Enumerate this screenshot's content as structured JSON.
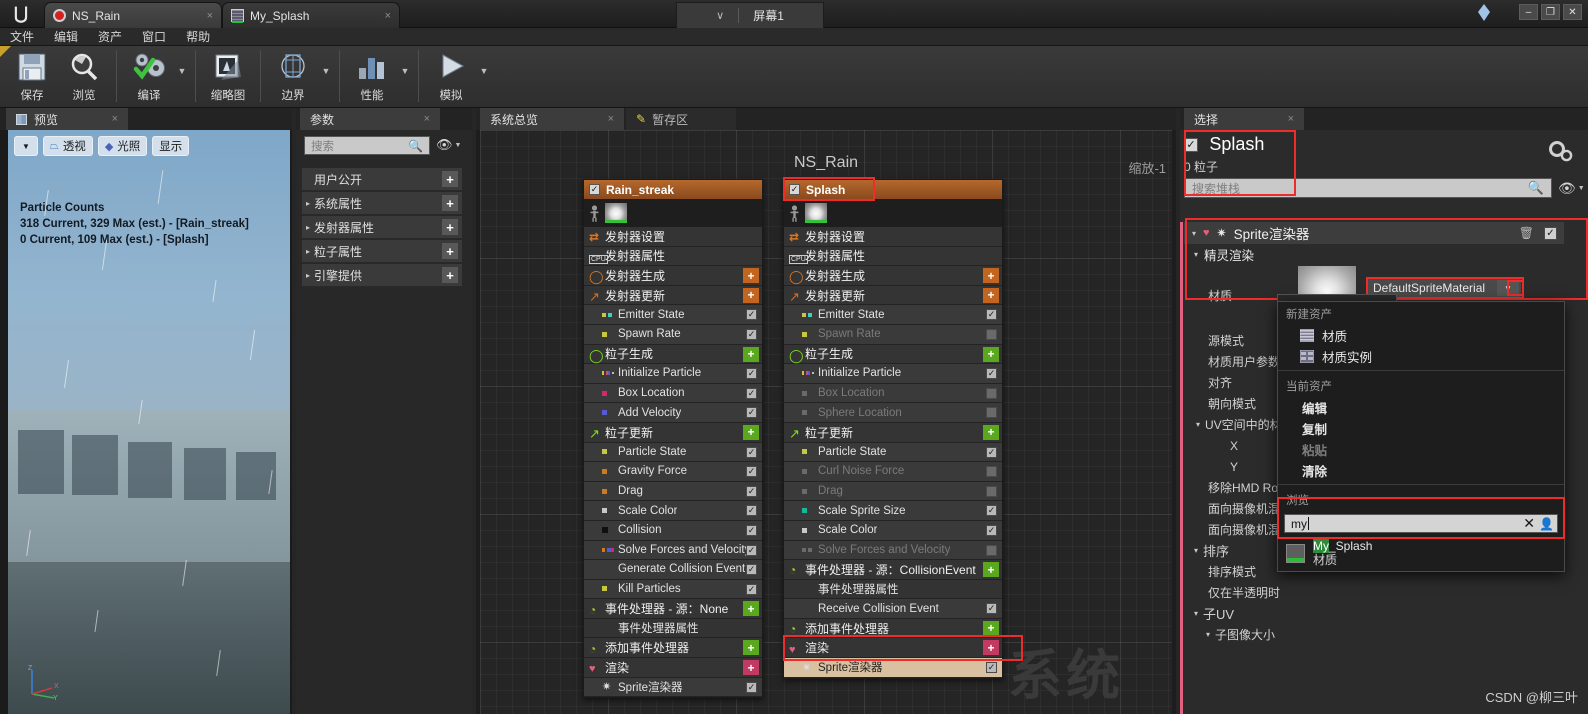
{
  "titlebar": {
    "logo": "ue-logo",
    "tabs": [
      {
        "label": "NS_Rain",
        "icon": "niagara-system-icon",
        "close": "×"
      },
      {
        "label": "My_Splash",
        "icon": "material-icon",
        "close": "×"
      }
    ],
    "screen_selector": {
      "chevron": "∨",
      "label": "屏幕1"
    },
    "window_controls": {
      "minimize": "–",
      "maximize": "❐",
      "close": "✕"
    }
  },
  "menubar": {
    "items": [
      "文件",
      "编辑",
      "资产",
      "窗口",
      "帮助"
    ]
  },
  "toolbar": {
    "items": [
      {
        "label": "保存",
        "icon": "save-icon",
        "arrow": false
      },
      {
        "label": "浏览",
        "icon": "browse-icon",
        "arrow": false
      },
      {
        "label": "编译",
        "icon": "compile-icon",
        "arrow": true
      },
      {
        "label": "缩略图",
        "icon": "thumbnail-icon",
        "arrow": false
      },
      {
        "label": "边界",
        "icon": "bounds-icon",
        "arrow": true
      },
      {
        "label": "性能",
        "icon": "performance-icon",
        "arrow": true
      },
      {
        "label": "模拟",
        "icon": "simulate-icon",
        "arrow": true
      }
    ]
  },
  "preview": {
    "tab_label": "预览",
    "tab_close": "×",
    "viewport_buttons": [
      {
        "label": "",
        "icon": "chevron-down-icon"
      },
      {
        "label": "透视",
        "icon": "perspective-icon"
      },
      {
        "label": "光照",
        "icon": "lighting-icon"
      },
      {
        "label": "显示",
        "icon": "show-icon"
      }
    ],
    "stats_title": "Particle Counts",
    "stats_lines": [
      "318 Current, 329 Max (est.) - [Rain_streak]",
      "0 Current, 109 Max (est.) - [Splash]"
    ],
    "axis": {
      "x": "X",
      "y": "Y",
      "z": "Z"
    }
  },
  "parameters": {
    "tab_label": "参数",
    "tab_close": "×",
    "search_placeholder": "搜索",
    "search_value": "",
    "rows": [
      {
        "label": "用户公开",
        "expandable": false,
        "plus": "+"
      },
      {
        "label": "系统属性",
        "expandable": true,
        "plus": "+"
      },
      {
        "label": "发射器属性",
        "expandable": true,
        "plus": "+"
      },
      {
        "label": "粒子属性",
        "expandable": true,
        "plus": "+"
      },
      {
        "label": "引擎提供",
        "expandable": true,
        "plus": "+"
      }
    ]
  },
  "graph": {
    "tabs": [
      {
        "label": "系统总览",
        "active": true,
        "close": "×",
        "icon": ""
      },
      {
        "label": "暂存区",
        "active": false,
        "close": "",
        "icon": "pencil-icon"
      }
    ],
    "title": "NS_Rain",
    "zoom_label": "缩放-1",
    "watermark": "系统",
    "emitters": [
      {
        "name": "Rain_streak",
        "checked": true,
        "rows": [
          {
            "label": "发射器设置",
            "kind": "header",
            "icon": "emitter-settings-icon",
            "control": "none",
            "dim": false
          },
          {
            "label": "发射器属性",
            "kind": "header",
            "icon": "cpu-icon",
            "control": "none",
            "dim": false
          },
          {
            "label": "发射器生成",
            "kind": "header",
            "icon": "emitter-spawn-icon",
            "control": "plus-orange",
            "dim": false
          },
          {
            "label": "发射器更新",
            "kind": "header",
            "icon": "emitter-update-icon",
            "control": "plus-orange",
            "dim": false
          },
          {
            "label": "Emitter State",
            "kind": "module",
            "icon": "module-dot-multi",
            "control": "check-on",
            "dim": false
          },
          {
            "label": "Spawn Rate",
            "kind": "module",
            "icon": "module-dot-yellow",
            "control": "check-on",
            "dim": false
          },
          {
            "label": "粒子生成",
            "kind": "header",
            "icon": "particle-spawn-icon",
            "control": "plus-green",
            "dim": false
          },
          {
            "label": "Initialize Particle",
            "kind": "module",
            "icon": "module-dot-multi2",
            "control": "check-on",
            "dim": false
          },
          {
            "label": "Box Location",
            "kind": "module",
            "icon": "module-dot-pink",
            "control": "check-on",
            "dim": false
          },
          {
            "label": "Add Velocity",
            "kind": "module",
            "icon": "module-dot-blue",
            "control": "check-on",
            "dim": false
          },
          {
            "label": "粒子更新",
            "kind": "header",
            "icon": "particle-update-icon",
            "control": "plus-green",
            "dim": false
          },
          {
            "label": "Particle State",
            "kind": "module",
            "icon": "module-dot-yellow",
            "control": "check-on",
            "dim": false
          },
          {
            "label": "Gravity Force",
            "kind": "module",
            "icon": "module-dot-orange",
            "control": "check-on",
            "dim": false
          },
          {
            "label": "Drag",
            "kind": "module",
            "icon": "module-dot-orange",
            "control": "check-on",
            "dim": false
          },
          {
            "label": "Scale Color",
            "kind": "module",
            "icon": "module-dot-white",
            "control": "check-on",
            "dim": false
          },
          {
            "label": "Collision",
            "kind": "module",
            "icon": "module-dot-black",
            "control": "check-on",
            "dim": false
          },
          {
            "label": "Solve Forces and Velocity",
            "kind": "module",
            "icon": "module-dot-multi3",
            "control": "check-on",
            "dim": false
          },
          {
            "label": "Generate Collision Event",
            "kind": "module",
            "icon": "module-dot-none",
            "control": "check-on",
            "dim": false
          },
          {
            "label": "Kill Particles",
            "kind": "module",
            "icon": "module-dot-yellow",
            "control": "check-on",
            "dim": false
          },
          {
            "label": "事件处理器 - 源：None",
            "kind": "header",
            "icon": "event-handler-icon",
            "control": "plus-green",
            "dim": false
          },
          {
            "label": "事件处理器属性",
            "kind": "sub",
            "icon": "module-dot-none",
            "control": "none",
            "dim": false
          },
          {
            "label": "添加事件处理器",
            "kind": "header",
            "icon": "event-handler-icon",
            "control": "plus-green",
            "dim": false
          },
          {
            "label": "渲染",
            "kind": "header",
            "icon": "render-icon",
            "control": "plus-pink",
            "dim": false
          },
          {
            "label": "Sprite渲染器",
            "kind": "module",
            "icon": "sprite-renderer-icon",
            "control": "check-on",
            "dim": false
          }
        ]
      },
      {
        "name": "Splash",
        "checked": true,
        "rows": [
          {
            "label": "发射器设置",
            "kind": "header",
            "icon": "emitter-settings-icon",
            "control": "none",
            "dim": false
          },
          {
            "label": "发射器属性",
            "kind": "header",
            "icon": "cpu-icon",
            "control": "none",
            "dim": false
          },
          {
            "label": "发射器生成",
            "kind": "header",
            "icon": "emitter-spawn-icon",
            "control": "plus-orange",
            "dim": false
          },
          {
            "label": "发射器更新",
            "kind": "header",
            "icon": "emitter-update-icon",
            "control": "plus-orange",
            "dim": false
          },
          {
            "label": "Emitter State",
            "kind": "module",
            "icon": "module-dot-multi",
            "control": "check-on",
            "dim": false
          },
          {
            "label": "Spawn Rate",
            "kind": "module",
            "icon": "module-dot-yellow",
            "control": "check-off",
            "dim": true
          },
          {
            "label": "粒子生成",
            "kind": "header",
            "icon": "particle-spawn-icon",
            "control": "plus-green",
            "dim": false
          },
          {
            "label": "Initialize Particle",
            "kind": "module",
            "icon": "module-dot-multi2",
            "control": "check-on",
            "dim": false
          },
          {
            "label": "Box Location",
            "kind": "module",
            "icon": "module-dot-dim",
            "control": "check-off",
            "dim": true
          },
          {
            "label": "Sphere Location",
            "kind": "module",
            "icon": "module-dot-dim",
            "control": "check-off",
            "dim": true
          },
          {
            "label": "粒子更新",
            "kind": "header",
            "icon": "particle-update-icon",
            "control": "plus-green",
            "dim": false
          },
          {
            "label": "Particle State",
            "kind": "module",
            "icon": "module-dot-yellow",
            "control": "check-on",
            "dim": false
          },
          {
            "label": "Curl Noise Force",
            "kind": "module",
            "icon": "module-dot-dim",
            "control": "check-off",
            "dim": true
          },
          {
            "label": "Drag",
            "kind": "module",
            "icon": "module-dot-dim",
            "control": "check-off",
            "dim": true
          },
          {
            "label": "Scale Sprite Size",
            "kind": "module",
            "icon": "module-dot-teal",
            "control": "check-on",
            "dim": false
          },
          {
            "label": "Scale Color",
            "kind": "module",
            "icon": "module-dot-white",
            "control": "check-on",
            "dim": false
          },
          {
            "label": "Solve Forces and Velocity",
            "kind": "module",
            "icon": "module-dot-dim2",
            "control": "check-off",
            "dim": true
          },
          {
            "label": "事件处理器 - 源：CollisionEvent",
            "kind": "header",
            "icon": "event-handler-icon",
            "control": "plus-green",
            "dim": false
          },
          {
            "label": "事件处理器属性",
            "kind": "sub",
            "icon": "module-dot-none",
            "control": "none",
            "dim": false
          },
          {
            "label": "Receive Collision Event",
            "kind": "module",
            "icon": "module-dot-none",
            "control": "check-on",
            "dim": false
          },
          {
            "label": "添加事件处理器",
            "kind": "header",
            "icon": "event-handler-icon",
            "control": "plus-green",
            "dim": false
          },
          {
            "label": "渲染",
            "kind": "header",
            "icon": "render-icon",
            "control": "plus-pink",
            "dim": false
          },
          {
            "label": "Sprite渲染器",
            "kind": "module",
            "icon": "sprite-renderer-icon",
            "control": "check-on",
            "dim": false,
            "selected": true
          }
        ]
      }
    ]
  },
  "selection": {
    "tab_label": "选择",
    "tab_close": "×",
    "emitter_name": "Splash",
    "emitter_checked": true,
    "particle_count": "0 粒子",
    "gear_icon": "settings-gear-icon",
    "search_placeholder": "搜索堆栈",
    "search_value": "",
    "stack_header": "Sprite渲染器",
    "stack_sub_header": "精灵渲染",
    "material_label": "材质",
    "material_value": "DefaultSpriteMaterial",
    "properties": [
      {
        "label": "源模式",
        "indent": 1
      },
      {
        "label": "材质用户参数",
        "indent": 1
      },
      {
        "label": "对齐",
        "indent": 1
      },
      {
        "label": "朝向模式",
        "indent": 1
      },
      {
        "label": "UV空间中的材",
        "indent": 0,
        "group": true
      },
      {
        "label": "X",
        "indent": 2
      },
      {
        "label": "Y",
        "indent": 2
      },
      {
        "label": "移除HMD Ro",
        "indent": 1
      },
      {
        "label": "面向摄像机混",
        "indent": 1
      },
      {
        "label": "面向摄像机混",
        "indent": 1
      },
      {
        "label": "排序",
        "indent": 0,
        "group": true
      },
      {
        "label": "排序模式",
        "indent": 1
      },
      {
        "label": "仅在半透明时",
        "indent": 1
      },
      {
        "label": "子UV",
        "indent": 0,
        "group": true
      },
      {
        "label": "子图像大小",
        "indent": 1,
        "group": true
      }
    ]
  },
  "asset_dropdown": {
    "section_new": "新建资产",
    "new_items": [
      {
        "label": "材质",
        "icon": "material-asset-icon"
      },
      {
        "label": "材质实例",
        "icon": "material-instance-icon"
      }
    ],
    "section_current": "当前资产",
    "current_items": [
      {
        "label": "编辑",
        "disabled": false
      },
      {
        "label": "复制",
        "disabled": false
      },
      {
        "label": "粘贴",
        "disabled": true
      },
      {
        "label": "清除",
        "disabled": false
      }
    ],
    "section_browse": "浏览",
    "search_value": "my",
    "clear_icon": "✕",
    "user_icon": "filter-user-icon",
    "results": [
      {
        "name_highlight": "My",
        "name_rest": "_Splash",
        "type": "材质",
        "icon": "material-thumb-icon"
      }
    ]
  },
  "footer": {
    "credit": "CSDN @柳三叶"
  },
  "colors": {
    "emitter_header": "#b5682c",
    "plus_orange": "#c4651f",
    "plus_green": "#5aa81e",
    "plus_pink": "#c23a62",
    "selection_highlight": "#d8c0a0",
    "red_outline": "#ef2c2c",
    "pink_bar": "#e4607f"
  }
}
